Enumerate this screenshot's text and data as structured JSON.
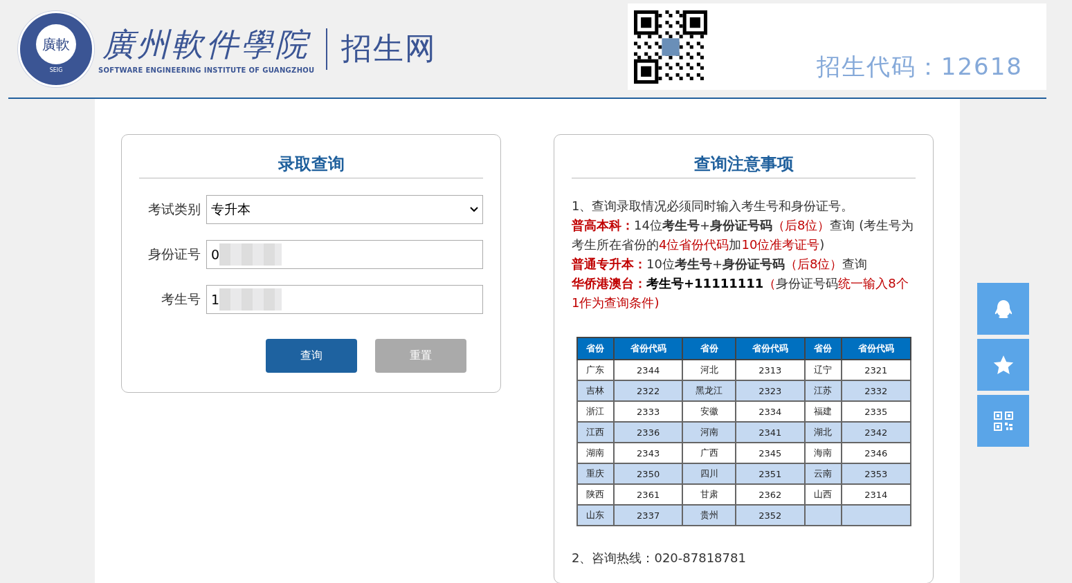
{
  "header": {
    "seal_text": "廣軟",
    "seal_caption": "SEIG",
    "school_name": "廣州軟件學院",
    "school_name_en": "SOFTWARE ENGINEERING INSTITUTE OF GUANGZHOU",
    "site_name": "招生网",
    "enroll_code": "招生代码：12618"
  },
  "query_form": {
    "title": "录取查询",
    "fields": [
      {
        "kind": "select",
        "label": "考试类别",
        "value": "专升本"
      },
      {
        "kind": "input",
        "label": "身份证号",
        "value": "0",
        "redacted": true
      },
      {
        "kind": "input",
        "label": "考生号",
        "value": "1",
        "redacted": true
      }
    ],
    "buttons": [
      {
        "label": "查询",
        "kind": "primary"
      },
      {
        "label": "重置",
        "kind": "secondary"
      }
    ]
  },
  "notice": {
    "title": "查询注意事项",
    "paragraphs": [
      [
        {
          "text": "1、查询录取情况必须同时输入考生号和身份证号。",
          "kind": "plain"
        }
      ],
      [
        {
          "text": "普高本科：",
          "kind": "red-bold"
        },
        {
          "text": "14位",
          "kind": "plain"
        },
        {
          "text": "考生号",
          "kind": "bold"
        },
        {
          "text": "+",
          "kind": "plain"
        },
        {
          "text": "身份证号码",
          "kind": "bold"
        },
        {
          "text": "（后8位）",
          "kind": "red"
        },
        {
          "text": "查询 (考生号为考生所在省份的",
          "kind": "plain"
        },
        {
          "text": "4位省份代码",
          "kind": "red"
        },
        {
          "text": "加",
          "kind": "plain"
        },
        {
          "text": "10位准考证号",
          "kind": "red"
        },
        {
          "text": ")",
          "kind": "plain"
        }
      ],
      [
        {
          "text": "普通专升本：",
          "kind": "red-bold"
        },
        {
          "text": "10位",
          "kind": "plain"
        },
        {
          "text": "考生号",
          "kind": "bold"
        },
        {
          "text": "+",
          "kind": "plain"
        },
        {
          "text": "身份证号码",
          "kind": "bold"
        },
        {
          "text": "（后8位）",
          "kind": "red"
        },
        {
          "text": "查询",
          "kind": "plain"
        }
      ],
      [
        {
          "text": "华侨港澳台：",
          "kind": "red-bold"
        },
        {
          "text": "考生号+11111111",
          "kind": "black-bold"
        },
        {
          "text": "（",
          "kind": "red"
        },
        {
          "text": "身份证号码",
          "kind": "plain"
        },
        {
          "text": "统一输入8个1作为查询条件)",
          "kind": "red"
        }
      ]
    ],
    "table": {
      "columns": [
        "省份",
        "省份代码",
        "省份",
        "省份代码",
        "省份",
        "省份代码"
      ],
      "rows": [
        [
          "广东",
          "2344",
          "河北",
          "2313",
          "辽宁",
          "2321"
        ],
        [
          "吉林",
          "2322",
          "黑龙江",
          "2323",
          "江苏",
          "2332"
        ],
        [
          "浙江",
          "2333",
          "安徽",
          "2334",
          "福建",
          "2335"
        ],
        [
          "江西",
          "2336",
          "河南",
          "2341",
          "湖北",
          "2342"
        ],
        [
          "湖南",
          "2343",
          "广西",
          "2345",
          "海南",
          "2346"
        ],
        [
          "重庆",
          "2350",
          "四川",
          "2351",
          "云南",
          "2353"
        ],
        [
          "陕西",
          "2361",
          "甘肃",
          "2362",
          "山西",
          "2314"
        ],
        [
          "山东",
          "2337",
          "贵州",
          "2352",
          "",
          ""
        ]
      ]
    },
    "hotline": "2、咨询热线：020-87818781"
  },
  "side_buttons": [
    {
      "kind": "chat"
    },
    {
      "kind": "star"
    },
    {
      "kind": "qr"
    }
  ]
}
